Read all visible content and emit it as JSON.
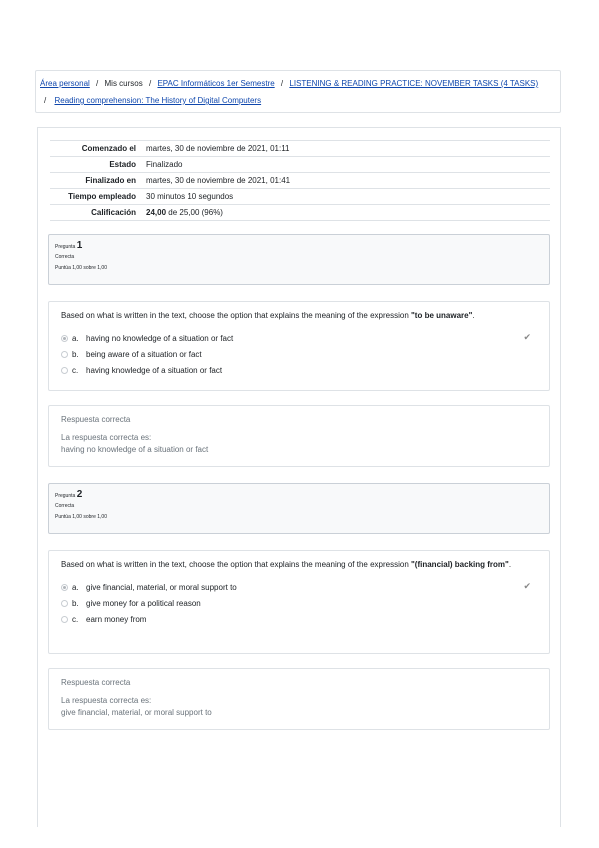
{
  "breadcrumb": {
    "home": "Área personal",
    "mycourses": "Mis cursos",
    "course": "EPAC Informáticos 1er Semestre",
    "section": "LISTENING & READING PRACTICE: NOVEMBER TASKS (4 TASKS)",
    "activity": "Reading comprehension: The History of Digital Computers",
    "separator": "/"
  },
  "summary": {
    "started_label": "Comenzado el",
    "started_value": "martes, 30 de noviembre de 2021, 01:11",
    "state_label": "Estado",
    "state_value": "Finalizado",
    "finished_label": "Finalizado en",
    "finished_value": "martes, 30 de noviembre de 2021, 01:41",
    "time_label": "Tiempo empleado",
    "time_value": "30 minutos 10 segundos",
    "grade_label": "Calificación",
    "grade_score": "24,00",
    "grade_rest": "de 25,00 (96%)"
  },
  "questions": [
    {
      "prefix": "Pregunta",
      "number": "1",
      "state": "Correcta",
      "grade": "Puntúa 1,00 sobre 1,00",
      "text_before": "Based on what is written in the text, choose the option that explains the meaning of the expression ",
      "expression": "\"to be unaware\"",
      "text_after": ".",
      "options": [
        {
          "letter": "a.",
          "text": "having no knowledge of a situation or fact",
          "selected": true
        },
        {
          "letter": "b.",
          "text": "being aware of a situation or fact",
          "selected": false
        },
        {
          "letter": "c.",
          "text": "having knowledge of a situation or fact",
          "selected": false
        }
      ],
      "feedback_title": "Respuesta correcta",
      "feedback_label": "La respuesta correcta es:",
      "feedback_answer": "having no knowledge of a situation or fact"
    },
    {
      "prefix": "Pregunta",
      "number": "2",
      "state": "Correcta",
      "grade": "Puntúa 1,00 sobre 1,00",
      "text_before": "Based on what is written in the text, choose the option that explains the meaning of the expression ",
      "expression": "\"(financial) backing from\"",
      "text_after": ".",
      "options": [
        {
          "letter": "a.",
          "text": "give financial, material, or moral support to",
          "selected": true
        },
        {
          "letter": "b.",
          "text": "give money for a political reason",
          "selected": false
        },
        {
          "letter": "c.",
          "text": "earn money from",
          "selected": false
        }
      ],
      "feedback_title": "Respuesta correcta",
      "feedback_label": "La respuesta correcta es:",
      "feedback_answer": "give financial, material, or moral support to"
    }
  ],
  "icons": {
    "correct": "check-icon"
  },
  "colors": {
    "link": "#0f47ad",
    "text": "#1d2125",
    "muted": "#6a737b",
    "border": "#dee2e6",
    "info_bg": "#f8f9fa"
  }
}
